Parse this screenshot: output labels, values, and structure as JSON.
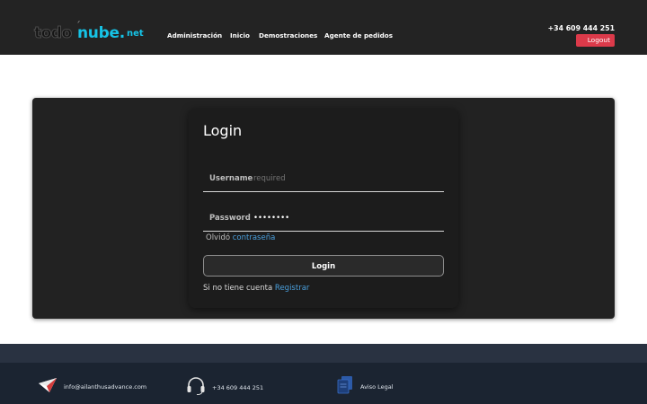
{
  "header": {
    "logo": {
      "todo": "todo",
      "nube": "nube.",
      "net": "net"
    },
    "nav": [
      "Administración",
      "Inicio",
      "Demostraciones",
      "Agente de pedidos"
    ],
    "phone": "+34 609 444 251",
    "logout_label": "Logout"
  },
  "login": {
    "title": "Login",
    "username_label": "Username",
    "username_placeholder": "required",
    "password_label": "Password",
    "password_value": "password",
    "forgot_prefix": "Olvidó",
    "forgot_link": "contraseña",
    "button_label": "Login",
    "register_prefix": "Si no tiene cuenta",
    "register_link": "Registrar"
  },
  "footer": {
    "email": "info@ailanthusadvance.com",
    "phone": "+34 609 444 251",
    "legal": "Aviso Legal"
  },
  "colors": {
    "header_bg": "#232323",
    "accent": "#16c3e6",
    "logout_bg": "#dc3a4a",
    "link": "#4a9fdc",
    "footer_bg": "#1b2431"
  },
  "icons": [
    "paper-plane-icon",
    "headset-icon",
    "documents-icon"
  ]
}
